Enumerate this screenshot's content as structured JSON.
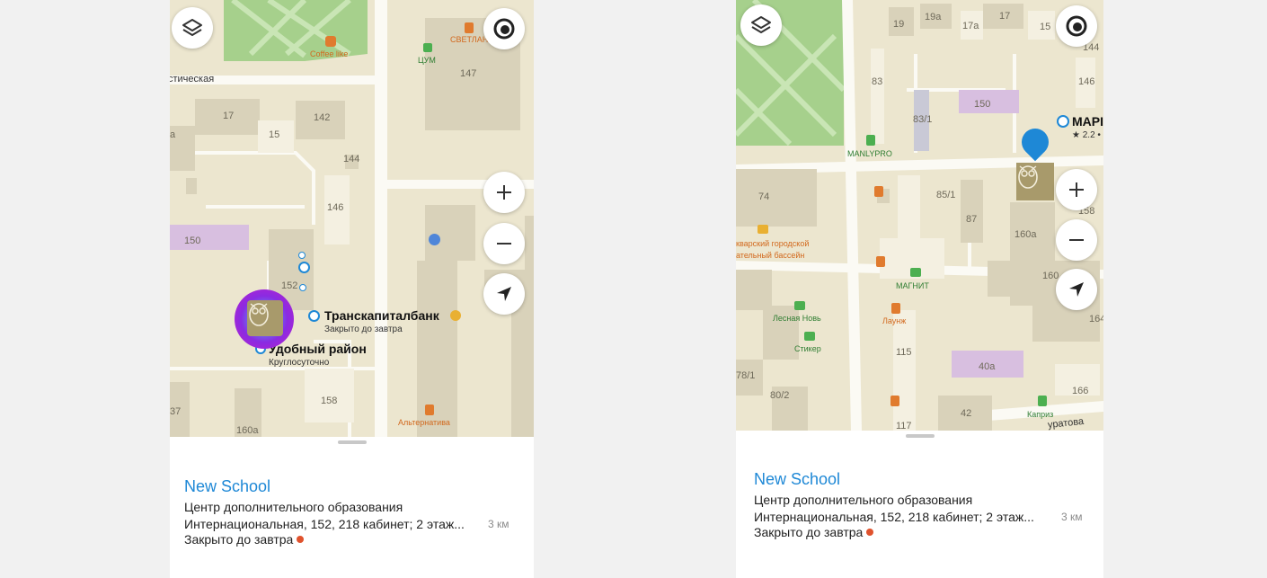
{
  "colors": {
    "accent": "#1e88d6",
    "closed_dot": "#e0522d",
    "map_bg": "#ece6cf",
    "building": "#d9d2ba",
    "park": "#a6d08c"
  },
  "left": {
    "map": {
      "street": "стическая",
      "buildings": [
        "17",
        "142",
        "15",
        "a",
        "144",
        "146",
        "150",
        "152",
        "147",
        "158",
        "160a",
        "37"
      ],
      "pois": {
        "coffee": "Coffee like",
        "cum": "ЦУМ",
        "svetlana": "СВЕТЛАН",
        "alternativa": "Альтернатива"
      },
      "bank": {
        "name": "Транскапиталбанк",
        "status": "Закрыто до завтра"
      },
      "district": {
        "name": "Удобный район",
        "status": "Круглосуточно"
      }
    },
    "card": {
      "name": "New School",
      "category": "Центр дополнительного образования",
      "address": "Интернациональная, 152, 218 кабинет; 2 этаж...",
      "distance": "3 км",
      "status": "Закрыто до завтра"
    }
  },
  "right": {
    "map": {
      "buildings": [
        "19",
        "19a",
        "17a",
        "17",
        "15",
        "144",
        "146",
        "83",
        "83/1",
        "150",
        "74",
        "85/1",
        "87",
        "160a",
        "160",
        "158",
        "164",
        "115",
        "40a",
        "42",
        "166",
        "78/1",
        "80/2",
        "117"
      ],
      "pois": {
        "manlypro": "MANLYPRO",
        "pool_1": "кварский городской",
        "pool_2": "ательный бассейн",
        "magnit": "МАГНИТ",
        "lesnaya": "Лесная Новь",
        "launzh": "Лаунж",
        "stiker": "Стикер",
        "kapriz": "Каприз",
        "street": "уратова"
      },
      "marker": {
        "name": "МАРІ",
        "rating": "★ 2.2 •"
      }
    },
    "card": {
      "name": "New School",
      "category": "Центр дополнительного образования",
      "address": "Интернациональная, 152, 218 кабинет; 2 этаж...",
      "distance": "3 км",
      "status": "Закрыто до завтра"
    }
  }
}
